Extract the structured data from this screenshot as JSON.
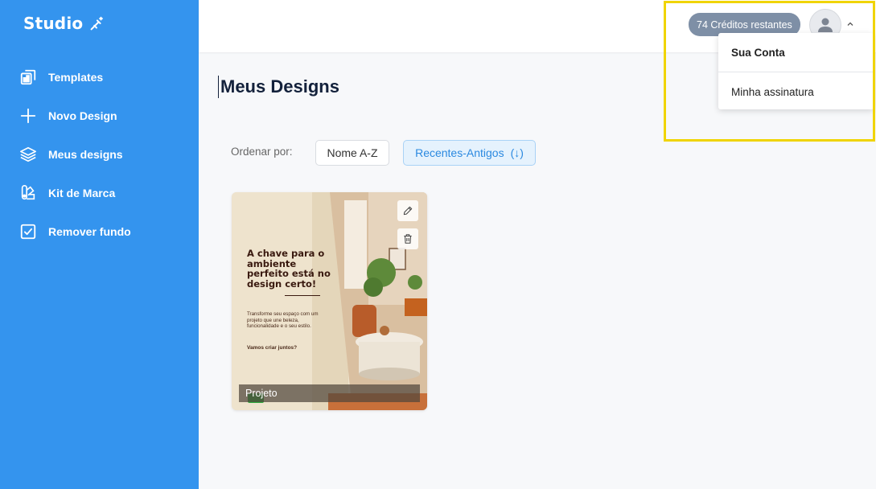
{
  "sidebar": {
    "brand": "Studio",
    "items": [
      {
        "label": "Templates",
        "icon": "templates-icon"
      },
      {
        "label": "Novo Design",
        "icon": "plus-icon"
      },
      {
        "label": "Meus designs",
        "icon": "layers-icon"
      },
      {
        "label": "Kit de Marca",
        "icon": "palette-icon"
      },
      {
        "label": "Remover fundo",
        "icon": "checkbox-icon"
      }
    ]
  },
  "header": {
    "credits": "74 Créditos restantes",
    "dropdown": {
      "account": "Sua Conta",
      "subscription": "Minha assinatura"
    }
  },
  "main": {
    "title": "Meus Designs",
    "sort_label": "Ordenar por:",
    "sort_name": "Nome A-Z",
    "sort_recent": "Recentes-Antigos",
    "sort_recent_arrow": "(↓)"
  },
  "card": {
    "caption": "Projeto",
    "headline": "A chave para o ambiente perfeito está no design certo!",
    "body": "Transforme seu espaço com um projeto que une beleza, funcionalidade e o seu estilo.",
    "cta": "Vamos criar juntos?"
  },
  "colors": {
    "sidebar": "#3494ee",
    "accent": "#2b89e0",
    "highlight": "#f0d400",
    "credits_badge": "#7e8fa6"
  }
}
